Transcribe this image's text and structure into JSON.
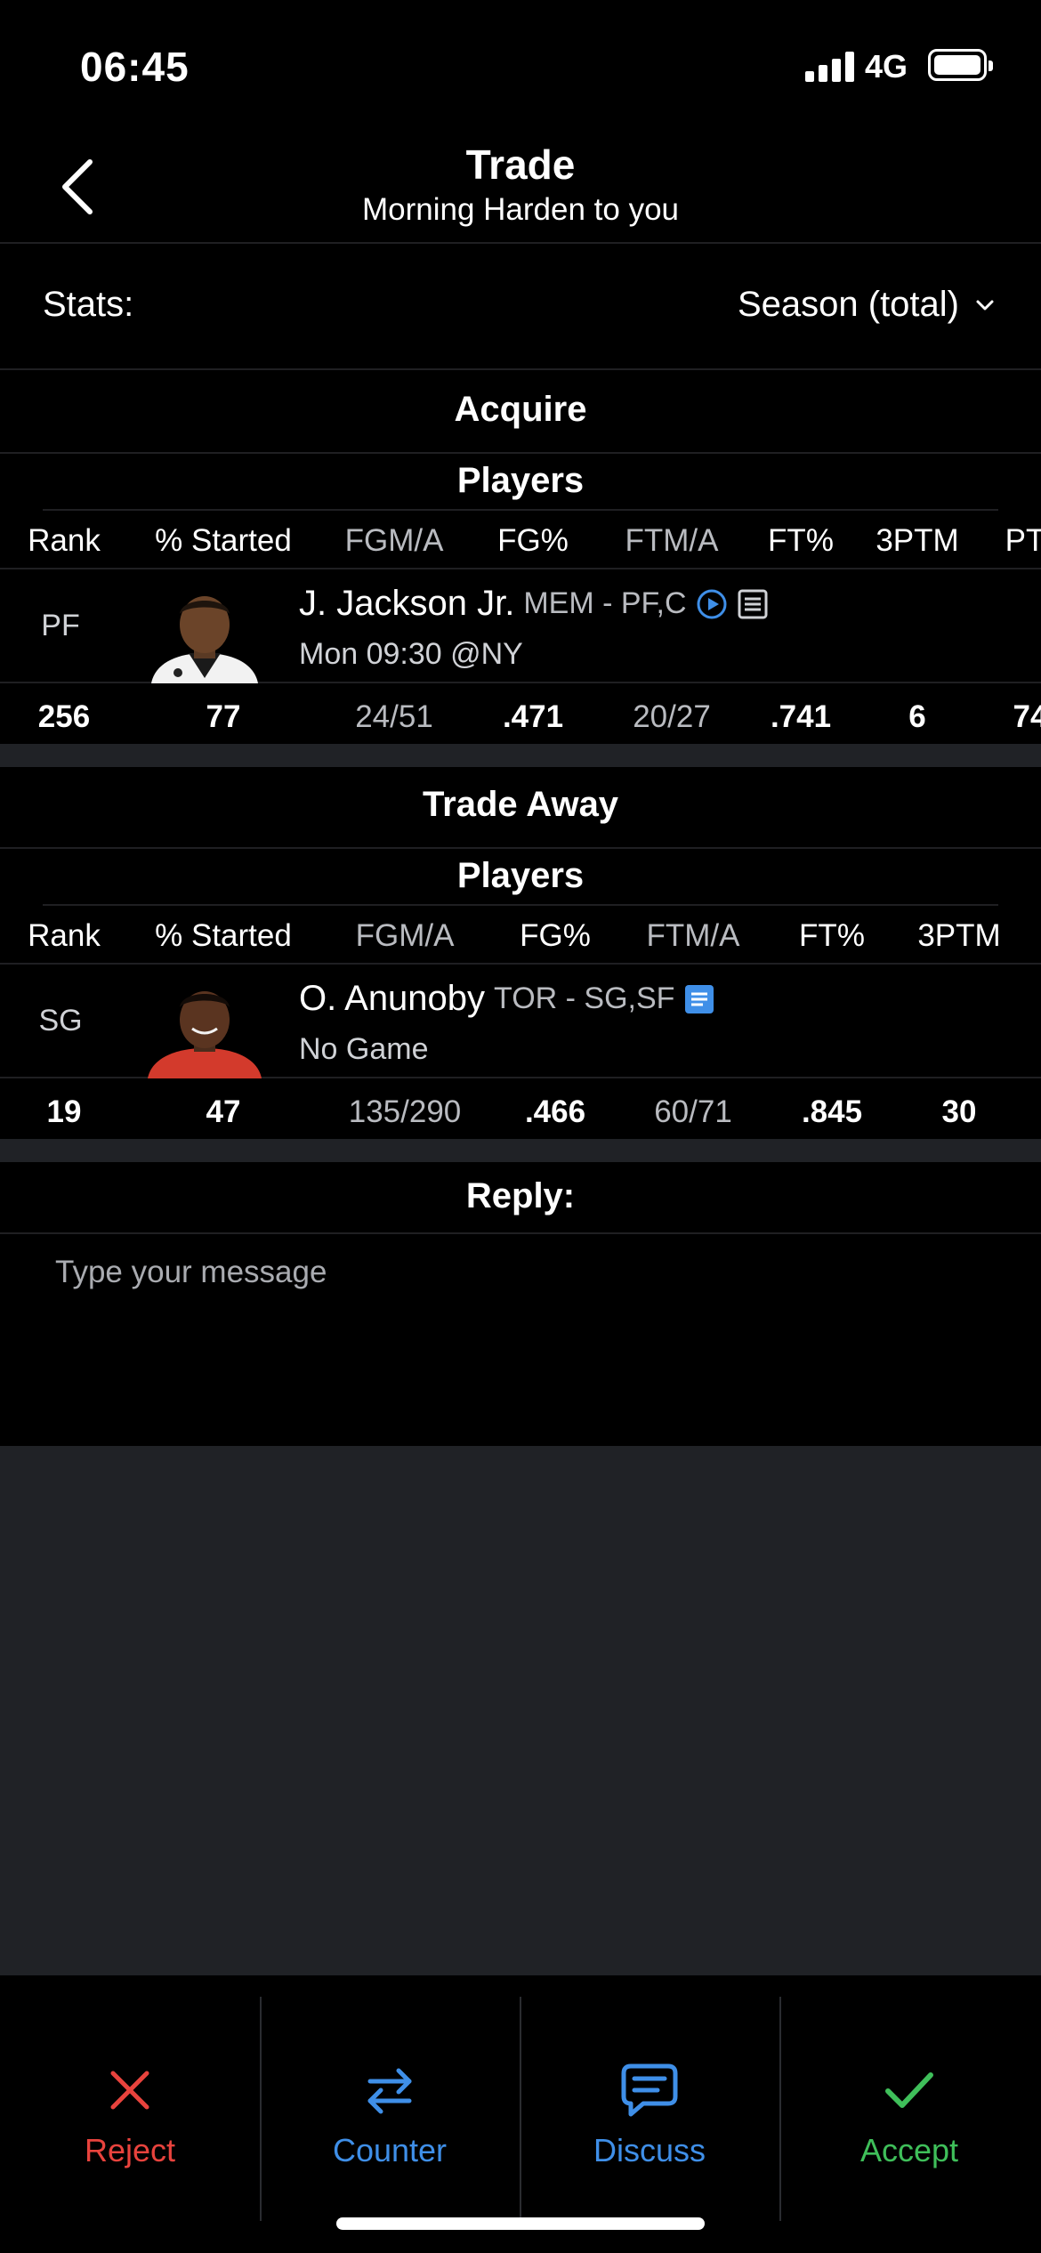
{
  "status_bar": {
    "time": "06:45",
    "network": "4G"
  },
  "header": {
    "title": "Trade",
    "subtitle": "Morning Harden to you"
  },
  "stats": {
    "label": "Stats:",
    "selected": "Season (total)"
  },
  "acquire": {
    "section_title": "Acquire",
    "players_title": "Players",
    "columns": [
      "Rank",
      "% Started",
      "FGM/A",
      "FG%",
      "FTM/A",
      "FT%",
      "3PTM",
      "PT"
    ],
    "player": {
      "position": "PF",
      "name": "J. Jackson Jr.",
      "team_pos": "MEM - PF,C",
      "game": "Mon 09:30 @NY",
      "stats": [
        "256",
        "77",
        "24/51",
        ".471",
        "20/27",
        ".741",
        "6",
        "74"
      ]
    }
  },
  "trade_away": {
    "section_title": "Trade Away",
    "players_title": "Players",
    "columns": [
      "Rank",
      "% Started",
      "FGM/A",
      "FG%",
      "FTM/A",
      "FT%",
      "3PTM"
    ],
    "player": {
      "position": "SG",
      "name": "O. Anunoby",
      "team_pos": "TOR - SG,SF",
      "game": "No Game",
      "stats": [
        "19",
        "47",
        "135/290",
        ".466",
        "60/71",
        ".845",
        "30"
      ]
    }
  },
  "reply": {
    "title": "Reply:",
    "placeholder": "Type your message"
  },
  "actions": {
    "reject": "Reject",
    "counter": "Counter",
    "discuss": "Discuss",
    "accept": "Accept"
  },
  "colors": {
    "reject": "#e8433d",
    "counter": "#3f8fe8",
    "discuss": "#3f8fe8",
    "accept": "#3fbf5a",
    "info_blue": "#3f8fe8"
  }
}
